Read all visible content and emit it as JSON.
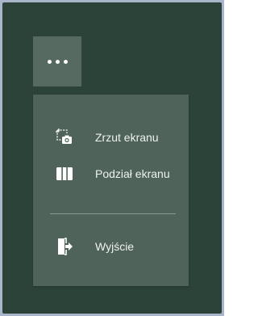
{
  "menu_button": {
    "icon": "more-horizontal-icon"
  },
  "menu": {
    "items": [
      {
        "label": "Zrzut ekranu",
        "icon": "screenshot-icon"
      },
      {
        "label": "Podział ekranu",
        "icon": "split-screen-icon"
      },
      {
        "label": "Wyjście",
        "icon": "exit-icon"
      }
    ]
  }
}
